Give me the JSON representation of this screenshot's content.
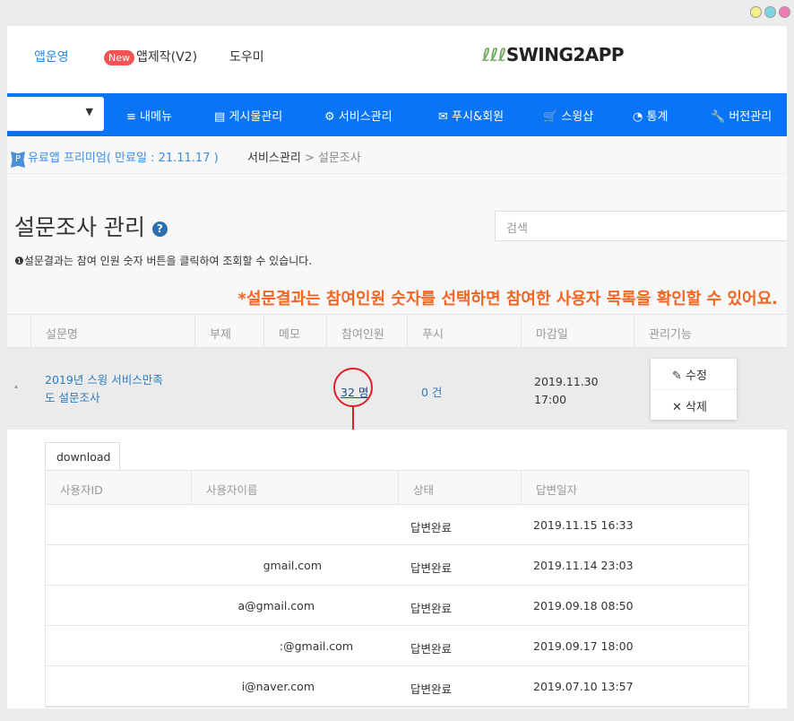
{
  "window": {
    "dot_colors": [
      "#f4f08c",
      "#7fd3e6",
      "#ef7ab4"
    ]
  },
  "header": {
    "links": [
      "앱운영",
      "앱제작(V2)",
      "도우미"
    ],
    "new_badge": "New",
    "logo": "SWING2APP"
  },
  "nav": {
    "select_arrow": "▼",
    "items": [
      {
        "icon": "≡",
        "label": "내메뉴"
      },
      {
        "icon": "▤",
        "label": "게시물관리"
      },
      {
        "icon": "⚙",
        "label": "서비스관리"
      },
      {
        "icon": "✉",
        "label": "푸시&회원"
      },
      {
        "icon": "🛒",
        "label": "스윙샵"
      },
      {
        "icon": "◔",
        "label": "통계"
      },
      {
        "icon": "🔧",
        "label": "버전관리"
      }
    ]
  },
  "breadcrumb": {
    "badge": "P",
    "plan": "유료앱 프리미엄( 만료일 : 21.11.17 )",
    "section": "서비스관리",
    "sep": " > ",
    "page": "설문조사"
  },
  "page": {
    "title": "설문조사 관리",
    "help": "?",
    "search_placeholder": "검색",
    "info": "❶설문결과는 참여 인원 숫자 버튼을 클릭하여 조회할 수 있습니다.",
    "note": "*설문결과는 참여인원 숫자를 선택하면 참여한 사용자 목록을 확인할 수 있어요."
  },
  "table": {
    "headers": [
      "설문명",
      "부제",
      "메모",
      "참여인원",
      "푸시",
      "마감일",
      "관리기능"
    ],
    "row": {
      "expander": "▴",
      "title1": "2019년 스윙 서비스만족",
      "title2": "도 설문조사",
      "participants": "32 명",
      "push": "0 건",
      "deadline1": "2019.11.30",
      "deadline2": "17:00",
      "edit": "✎ 수정",
      "delete": "✕ 삭제"
    }
  },
  "results": {
    "download": "download",
    "headers": [
      "사용자ID",
      "사용자이름",
      "상태",
      "답변일자"
    ],
    "rows": [
      {
        "name": "",
        "status": "답변완료",
        "date": "2019.11.15 16:33"
      },
      {
        "name": "gmail.com",
        "status": "답변완료",
        "date": "2019.11.14 23:03"
      },
      {
        "name": "a@gmail.com",
        "status": "답변완료",
        "date": "2019.09.18 08:50"
      },
      {
        "name": ":@gmail.com",
        "status": "답변완료",
        "date": "2019.09.17 18:00"
      },
      {
        "name": "i@naver.com",
        "status": "답변완료",
        "date": "2019.07.10 13:57"
      }
    ]
  }
}
